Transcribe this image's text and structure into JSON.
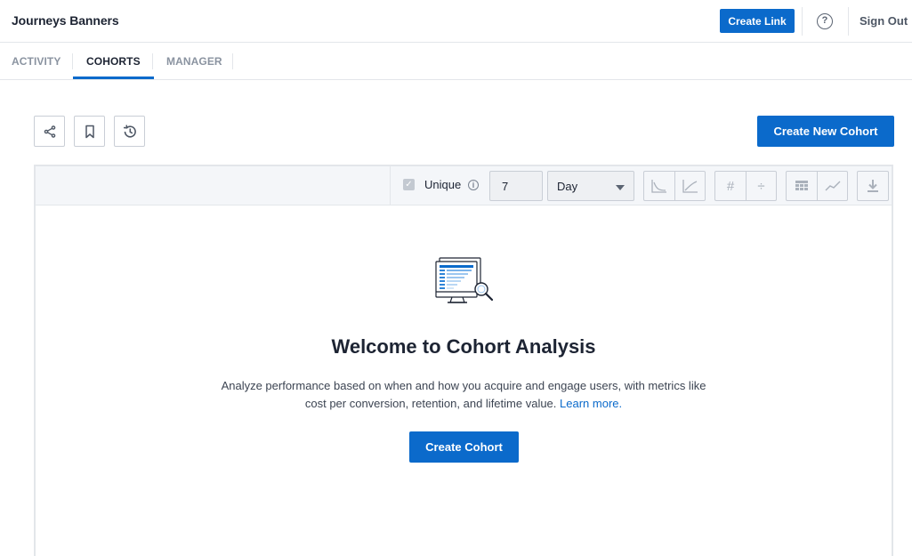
{
  "header": {
    "app_title": "Journeys Banners",
    "create_link_label": "Create Link",
    "help_icon": "question-circle-icon",
    "sign_out_label": "Sign Out"
  },
  "tabs": [
    {
      "label": "ACTIVITY",
      "active": false
    },
    {
      "label": "COHORTS",
      "active": true
    },
    {
      "label": "MANAGER",
      "active": false
    }
  ],
  "actions": {
    "share_icon": "share-icon",
    "bookmark_icon": "bookmark-icon",
    "history_icon": "history-icon",
    "create_new_cohort_label": "Create New Cohort"
  },
  "toolbar": {
    "unique_label": "Unique",
    "unique_checked": true,
    "period_value": "7",
    "period_unit": "Day",
    "buttons": [
      "retention-curve-down-icon",
      "retention-curve-up-icon",
      "count-hash-icon",
      "divide-icon",
      "table-grid-icon",
      "line-chart-icon",
      "download-icon"
    ]
  },
  "empty_state": {
    "title": "Welcome to Cohort Analysis",
    "description_1": "Analyze performance based on when and how you acquire and engage users, with metrics like cost per conversion, retention, and lifetime value.",
    "learn_more": "Learn more.",
    "button_label": "Create Cohort"
  },
  "colors": {
    "accent": "#0b6acb",
    "border": "#e3e6ea",
    "toolbar_bg": "#f4f6f9"
  }
}
